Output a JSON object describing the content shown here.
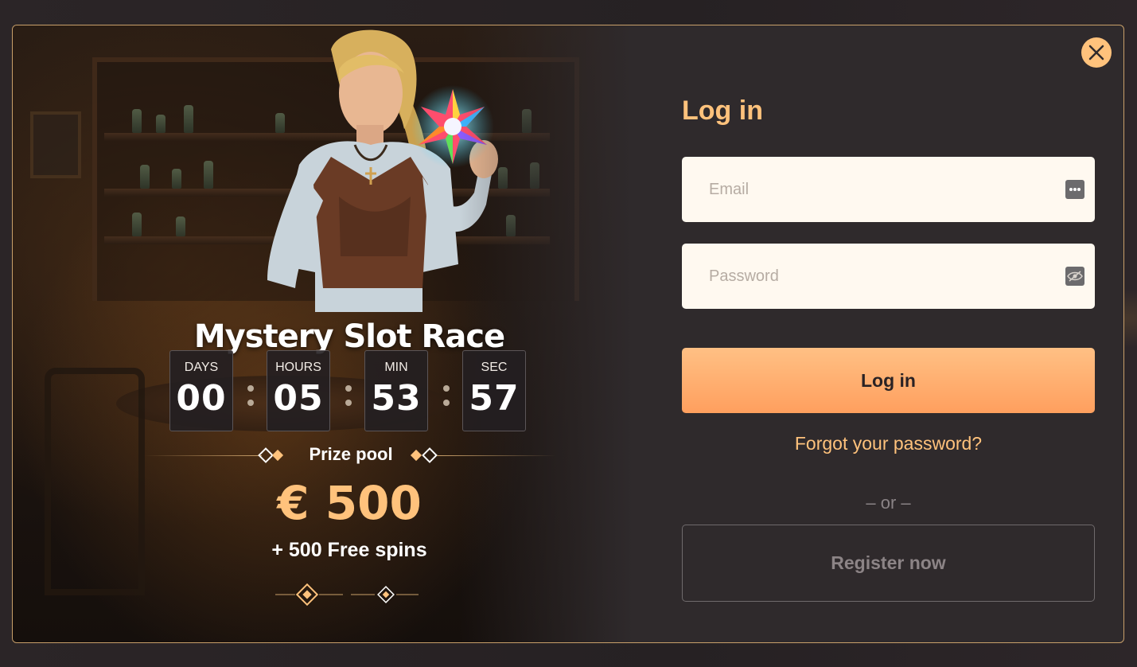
{
  "promo": {
    "title": "Mystery Slot Race",
    "countdown": [
      {
        "label": "DAYS",
        "value": "00"
      },
      {
        "label": "HOURS",
        "value": "05"
      },
      {
        "label": "MIN",
        "value": "53"
      },
      {
        "label": "SEC",
        "value": "57"
      }
    ],
    "prize_label": "Prize pool",
    "prize_amount": "€ 500",
    "prize_extra": "+ 500 Free spins"
  },
  "login": {
    "title": "Log in",
    "email_placeholder": "Email",
    "password_placeholder": "Password",
    "login_button": "Log in",
    "forgot_link": "Forgot your password?",
    "or_separator": "– or –",
    "register_button": "Register now"
  },
  "icons": {
    "close": "close-icon",
    "email_field": "password-manager-icon",
    "password_field": "password-visibility-icon",
    "promo_art": "character-illustration",
    "gem": "star-gem-icon"
  },
  "colors": {
    "accent": "#ffc27c",
    "border": "#c9a06a",
    "button_gradient_top": "#ffc084",
    "button_gradient_bottom": "#ff9f5e",
    "panel": "#2f2a2c",
    "input_bg": "#fff9f0"
  }
}
